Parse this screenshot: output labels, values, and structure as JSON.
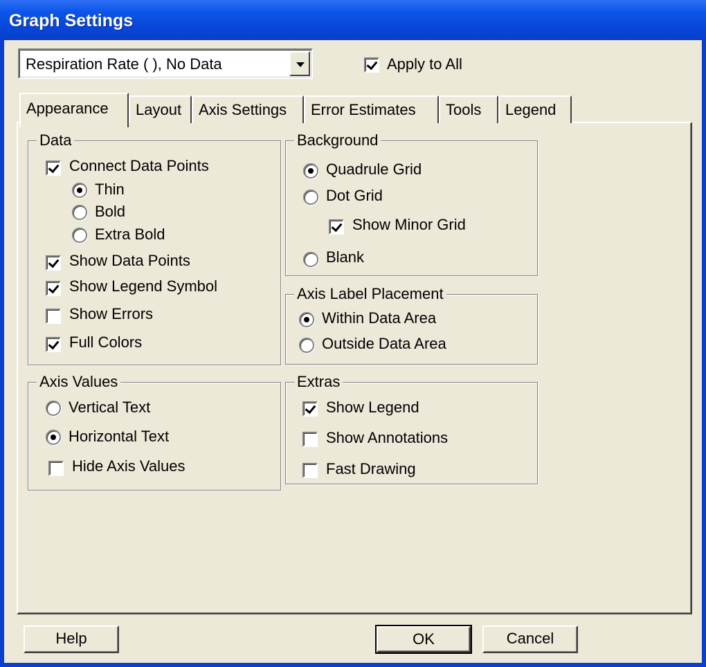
{
  "window": {
    "title": "Graph Settings"
  },
  "series_select": {
    "value": "Respiration Rate ( ), No Data"
  },
  "apply_to_all": {
    "label": "Apply to All",
    "checked": true
  },
  "tabs": [
    {
      "label": "Appearance",
      "active": true
    },
    {
      "label": "Layout",
      "active": false
    },
    {
      "label": "Axis Settings",
      "active": false
    },
    {
      "label": "Error Estimates",
      "active": false
    },
    {
      "label": "Tools",
      "active": false
    },
    {
      "label": "Legend",
      "active": false
    }
  ],
  "data_group": {
    "title": "Data",
    "connect_points": {
      "label": "Connect Data Points",
      "checked": true
    },
    "line_widths": [
      {
        "label": "Thin",
        "selected": true
      },
      {
        "label": "Bold",
        "selected": false
      },
      {
        "label": "Extra Bold",
        "selected": false
      }
    ],
    "show_points": {
      "label": "Show Data Points",
      "checked": true
    },
    "show_legend_symbol": {
      "label": "Show Legend Symbol",
      "checked": true
    },
    "show_errors": {
      "label": "Show Errors",
      "checked": false
    },
    "full_colors": {
      "label": "Full Colors",
      "checked": true
    }
  },
  "background_group": {
    "title": "Background",
    "quadrule": {
      "label": "Quadrule Grid",
      "selected": true
    },
    "dot_grid": {
      "label": "Dot Grid",
      "selected": false
    },
    "minor_grid": {
      "label": "Show Minor Grid",
      "checked": true
    },
    "blank": {
      "label": "Blank",
      "selected": false
    }
  },
  "axis_label_group": {
    "title": "Axis Label Placement",
    "within": {
      "label": "Within Data Area",
      "selected": true
    },
    "outside": {
      "label": "Outside Data Area",
      "selected": false
    }
  },
  "axis_values_group": {
    "title": "Axis Values",
    "vertical": {
      "label": "Vertical Text",
      "selected": false
    },
    "horizontal": {
      "label": "Horizontal Text",
      "selected": true
    },
    "hide": {
      "label": "Hide Axis Values",
      "checked": false
    }
  },
  "extras_group": {
    "title": "Extras",
    "show_legend": {
      "label": "Show Legend",
      "checked": true
    },
    "show_annotations": {
      "label": "Show Annotations",
      "checked": false
    },
    "fast_drawing": {
      "label": "Fast Drawing",
      "checked": false
    }
  },
  "buttons": {
    "help": "Help",
    "ok": "OK",
    "cancel": "Cancel"
  }
}
